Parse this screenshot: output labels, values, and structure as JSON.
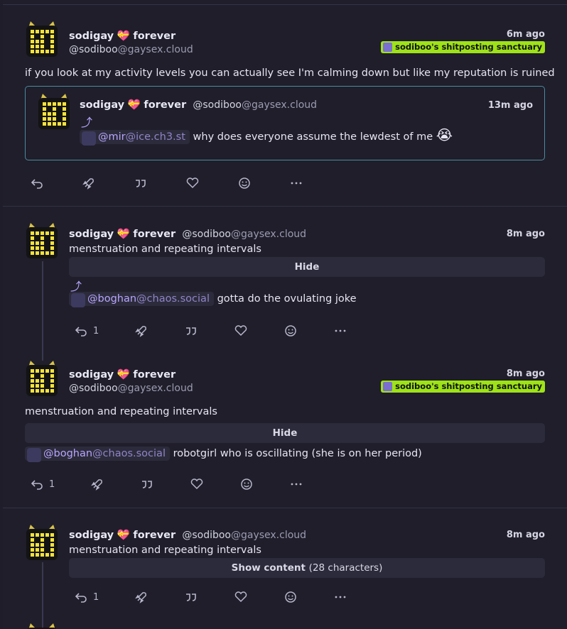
{
  "colors": {
    "background": "#1f1e2a",
    "accent": "#b8a6ff",
    "channel": "#9ee317",
    "quote_border": "#4c8aa0"
  },
  "notes": [
    {
      "author_name": "sodigay",
      "author_suffix": "forever",
      "handle_user": "@sodiboo",
      "handle_host": "@gaysex.cloud",
      "time": "6m ago",
      "channel": "sodiboo's shitposting sanctuary",
      "text": "if you look at my activity levels you can actually see I'm calming down but like my reputation is ruined",
      "quote": {
        "author_name": "sodigay",
        "author_suffix": "forever",
        "handle_user": "@sodiboo",
        "handle_host": "@gaysex.cloud",
        "time": "13m ago",
        "mention_user": "@mir",
        "mention_host": "@ice.ch3.st",
        "text": "why does everyone assume the lewdest of me",
        "emoji": "😭"
      }
    },
    {
      "author_name": "sodigay",
      "author_suffix": "forever",
      "handle_user": "@sodiboo",
      "handle_host": "@gaysex.cloud",
      "time": "8m ago",
      "cw": "menstruation and repeating intervals",
      "hide_label": "Hide",
      "mention_user": "@boghan",
      "mention_host": "@chaos.social",
      "text": "gotta do the ovulating joke",
      "reply_count": "1"
    },
    {
      "author_name": "sodigay",
      "author_suffix": "forever",
      "handle_user": "@sodiboo",
      "handle_host": "@gaysex.cloud",
      "time": "8m ago",
      "channel": "sodiboo's shitposting sanctuary",
      "cw": "menstruation and repeating intervals",
      "hide_label": "Hide",
      "mention_user": "@boghan",
      "mention_host": "@chaos.social",
      "text": "robotgirl who is oscillating (she is on her period)",
      "reply_count": "1"
    },
    {
      "author_name": "sodigay",
      "author_suffix": "forever",
      "handle_user": "@sodiboo",
      "handle_host": "@gaysex.cloud",
      "time": "8m ago",
      "cw": "menstruation and repeating intervals",
      "show_label": "Show content",
      "show_count": "(28 characters)",
      "reply_count": "1"
    }
  ]
}
